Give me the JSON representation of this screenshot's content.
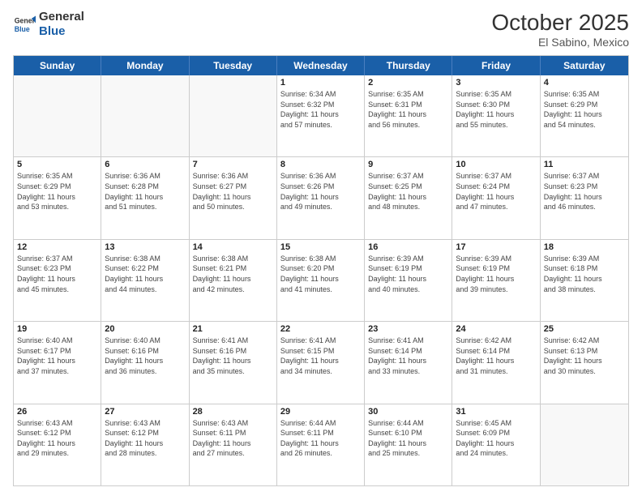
{
  "header": {
    "logo_line1": "General",
    "logo_line2": "Blue",
    "month_title": "October 2025",
    "subtitle": "El Sabino, Mexico"
  },
  "day_headers": [
    "Sunday",
    "Monday",
    "Tuesday",
    "Wednesday",
    "Thursday",
    "Friday",
    "Saturday"
  ],
  "weeks": [
    [
      {
        "num": "",
        "info": ""
      },
      {
        "num": "",
        "info": ""
      },
      {
        "num": "",
        "info": ""
      },
      {
        "num": "1",
        "info": "Sunrise: 6:34 AM\nSunset: 6:32 PM\nDaylight: 11 hours\nand 57 minutes."
      },
      {
        "num": "2",
        "info": "Sunrise: 6:35 AM\nSunset: 6:31 PM\nDaylight: 11 hours\nand 56 minutes."
      },
      {
        "num": "3",
        "info": "Sunrise: 6:35 AM\nSunset: 6:30 PM\nDaylight: 11 hours\nand 55 minutes."
      },
      {
        "num": "4",
        "info": "Sunrise: 6:35 AM\nSunset: 6:29 PM\nDaylight: 11 hours\nand 54 minutes."
      }
    ],
    [
      {
        "num": "5",
        "info": "Sunrise: 6:35 AM\nSunset: 6:29 PM\nDaylight: 11 hours\nand 53 minutes."
      },
      {
        "num": "6",
        "info": "Sunrise: 6:36 AM\nSunset: 6:28 PM\nDaylight: 11 hours\nand 51 minutes."
      },
      {
        "num": "7",
        "info": "Sunrise: 6:36 AM\nSunset: 6:27 PM\nDaylight: 11 hours\nand 50 minutes."
      },
      {
        "num": "8",
        "info": "Sunrise: 6:36 AM\nSunset: 6:26 PM\nDaylight: 11 hours\nand 49 minutes."
      },
      {
        "num": "9",
        "info": "Sunrise: 6:37 AM\nSunset: 6:25 PM\nDaylight: 11 hours\nand 48 minutes."
      },
      {
        "num": "10",
        "info": "Sunrise: 6:37 AM\nSunset: 6:24 PM\nDaylight: 11 hours\nand 47 minutes."
      },
      {
        "num": "11",
        "info": "Sunrise: 6:37 AM\nSunset: 6:23 PM\nDaylight: 11 hours\nand 46 minutes."
      }
    ],
    [
      {
        "num": "12",
        "info": "Sunrise: 6:37 AM\nSunset: 6:23 PM\nDaylight: 11 hours\nand 45 minutes."
      },
      {
        "num": "13",
        "info": "Sunrise: 6:38 AM\nSunset: 6:22 PM\nDaylight: 11 hours\nand 44 minutes."
      },
      {
        "num": "14",
        "info": "Sunrise: 6:38 AM\nSunset: 6:21 PM\nDaylight: 11 hours\nand 42 minutes."
      },
      {
        "num": "15",
        "info": "Sunrise: 6:38 AM\nSunset: 6:20 PM\nDaylight: 11 hours\nand 41 minutes."
      },
      {
        "num": "16",
        "info": "Sunrise: 6:39 AM\nSunset: 6:19 PM\nDaylight: 11 hours\nand 40 minutes."
      },
      {
        "num": "17",
        "info": "Sunrise: 6:39 AM\nSunset: 6:19 PM\nDaylight: 11 hours\nand 39 minutes."
      },
      {
        "num": "18",
        "info": "Sunrise: 6:39 AM\nSunset: 6:18 PM\nDaylight: 11 hours\nand 38 minutes."
      }
    ],
    [
      {
        "num": "19",
        "info": "Sunrise: 6:40 AM\nSunset: 6:17 PM\nDaylight: 11 hours\nand 37 minutes."
      },
      {
        "num": "20",
        "info": "Sunrise: 6:40 AM\nSunset: 6:16 PM\nDaylight: 11 hours\nand 36 minutes."
      },
      {
        "num": "21",
        "info": "Sunrise: 6:41 AM\nSunset: 6:16 PM\nDaylight: 11 hours\nand 35 minutes."
      },
      {
        "num": "22",
        "info": "Sunrise: 6:41 AM\nSunset: 6:15 PM\nDaylight: 11 hours\nand 34 minutes."
      },
      {
        "num": "23",
        "info": "Sunrise: 6:41 AM\nSunset: 6:14 PM\nDaylight: 11 hours\nand 33 minutes."
      },
      {
        "num": "24",
        "info": "Sunrise: 6:42 AM\nSunset: 6:14 PM\nDaylight: 11 hours\nand 31 minutes."
      },
      {
        "num": "25",
        "info": "Sunrise: 6:42 AM\nSunset: 6:13 PM\nDaylight: 11 hours\nand 30 minutes."
      }
    ],
    [
      {
        "num": "26",
        "info": "Sunrise: 6:43 AM\nSunset: 6:12 PM\nDaylight: 11 hours\nand 29 minutes."
      },
      {
        "num": "27",
        "info": "Sunrise: 6:43 AM\nSunset: 6:12 PM\nDaylight: 11 hours\nand 28 minutes."
      },
      {
        "num": "28",
        "info": "Sunrise: 6:43 AM\nSunset: 6:11 PM\nDaylight: 11 hours\nand 27 minutes."
      },
      {
        "num": "29",
        "info": "Sunrise: 6:44 AM\nSunset: 6:11 PM\nDaylight: 11 hours\nand 26 minutes."
      },
      {
        "num": "30",
        "info": "Sunrise: 6:44 AM\nSunset: 6:10 PM\nDaylight: 11 hours\nand 25 minutes."
      },
      {
        "num": "31",
        "info": "Sunrise: 6:45 AM\nSunset: 6:09 PM\nDaylight: 11 hours\nand 24 minutes."
      },
      {
        "num": "",
        "info": ""
      }
    ]
  ]
}
